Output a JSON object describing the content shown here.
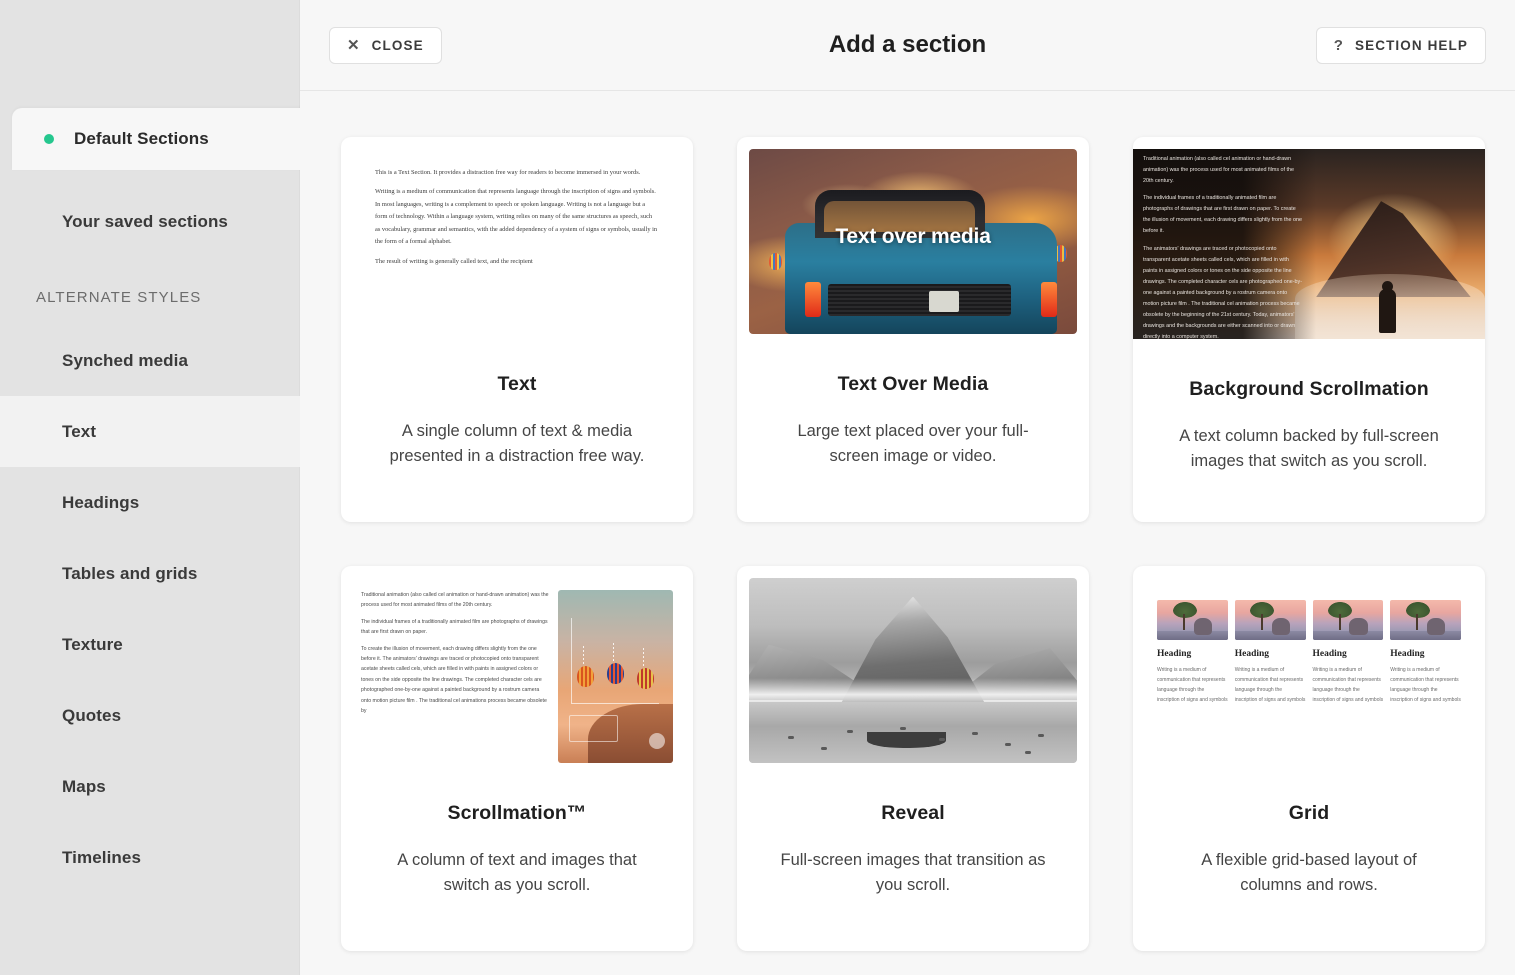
{
  "header": {
    "close_label": "CLOSE",
    "close_icon": "close-x-icon",
    "title": "Add a section",
    "help_label": "SECTION HELP",
    "help_icon": "question-mark-icon"
  },
  "sidebar": {
    "active_tab": "Default Sections",
    "accent_dot_color": "#25c78e",
    "background_color": "#e3e3e3",
    "saved_label": "Your saved sections",
    "group_label": "ALTERNATE STYLES",
    "items": [
      {
        "label": "Synched media",
        "active": false
      },
      {
        "label": "Text",
        "active": true
      },
      {
        "label": "Headings",
        "active": false
      },
      {
        "label": "Tables and grids",
        "active": false
      },
      {
        "label": "Texture",
        "active": false
      },
      {
        "label": "Quotes",
        "active": false
      },
      {
        "label": "Maps",
        "active": false
      },
      {
        "label": "Timelines",
        "active": false
      }
    ]
  },
  "cards": [
    {
      "title": "Text",
      "description": "A single column of text & media presented in a distraction free way.",
      "preview": {
        "type": "text-column",
        "paragraphs": [
          "This is a Text Section. It provides a distraction free way for readers to become immersed in your words.",
          "Writing is a medium of communication that represents language through the inscription of signs and symbols. In most languages, writing is a complement to speech or spoken language. Writing is not a language but a form of technology. Within a language system, writing relies on many of the same structures as speech, such as vocabulary, grammar and semantics, with the added dependency of a system of signs or symbols, usually in the form of a formal alphabet.",
          "The result of writing is generally called text, and the recipient"
        ]
      }
    },
    {
      "title": "Text Over Media",
      "description": "Large text placed over your full-screen image or video.",
      "preview": {
        "type": "media-overlay",
        "overlay_text": "Text over media"
      }
    },
    {
      "title": "Background Scrollmation",
      "description": "A text column backed by full-screen images that switch as you scroll.",
      "preview": {
        "type": "dark-text-over-photo",
        "paragraphs": [
          "Traditional animation (also called cel animation or hand-drawn animation) was the process used for most animated films of the 20th century.",
          "The individual frames of a traditionally animated film are photographs of drawings that are first drawn on paper. To create the illusion of movement, each drawing differs slightly from the one before it.",
          "The animators' drawings are traced or photocopied onto transparent acetate sheets called cels, which are filled in with paints in assigned colors or tones on the side opposite the line drawings. The completed character cels are photographed one-by-one against a painted background by a rostrum camera onto motion picture film . The traditional cel animation process became obsolete by the beginning of the 21st century. Today, animators' drawings and the backgrounds are either scanned into or drawn directly into a computer system."
        ]
      }
    },
    {
      "title": "Scrollmation™",
      "description": "A column of text and images that switch as you scroll.",
      "preview": {
        "type": "text-plus-image",
        "paragraphs": [
          "Traditional animation (also called cel animation or hand-drawn animation) was the process used for most animated films of the 20th century.",
          "The individual frames of a traditionally animated film are photographs of drawings that are first drawn on paper.",
          "To create the illusion of movement, each drawing differs slightly from the one before it. The animators' drawings are traced or photocopied onto transparent acetate sheets called cels, which are filled in with paints in assigned colors or tones on the side opposite the line drawings. The completed character cels are photographed one-by-one against a painted background by a rostrum camera onto motion picture film . The traditional cel animations process became obsolete by"
        ]
      }
    },
    {
      "title": "Reveal",
      "description": "Full-screen images that transition as you scroll.",
      "preview": {
        "type": "grayscale-photo"
      }
    },
    {
      "title": "Grid",
      "description": "A flexible grid-based layout of columns and rows.",
      "preview": {
        "type": "grid-columns",
        "columns": [
          {
            "heading": "Heading",
            "body": "Writing is a medium of communication that represents language through the inscription of signs and symbols"
          },
          {
            "heading": "Heading",
            "body": "Writing is a medium of communication that represents language through the inscription of signs and symbols"
          },
          {
            "heading": "Heading",
            "body": "Writing is a medium of communication that represents language through the inscription of signs and symbols"
          },
          {
            "heading": "Heading",
            "body": "Writing is a medium of communication that represents language through the inscription of signs and symbols"
          }
        ]
      }
    }
  ]
}
